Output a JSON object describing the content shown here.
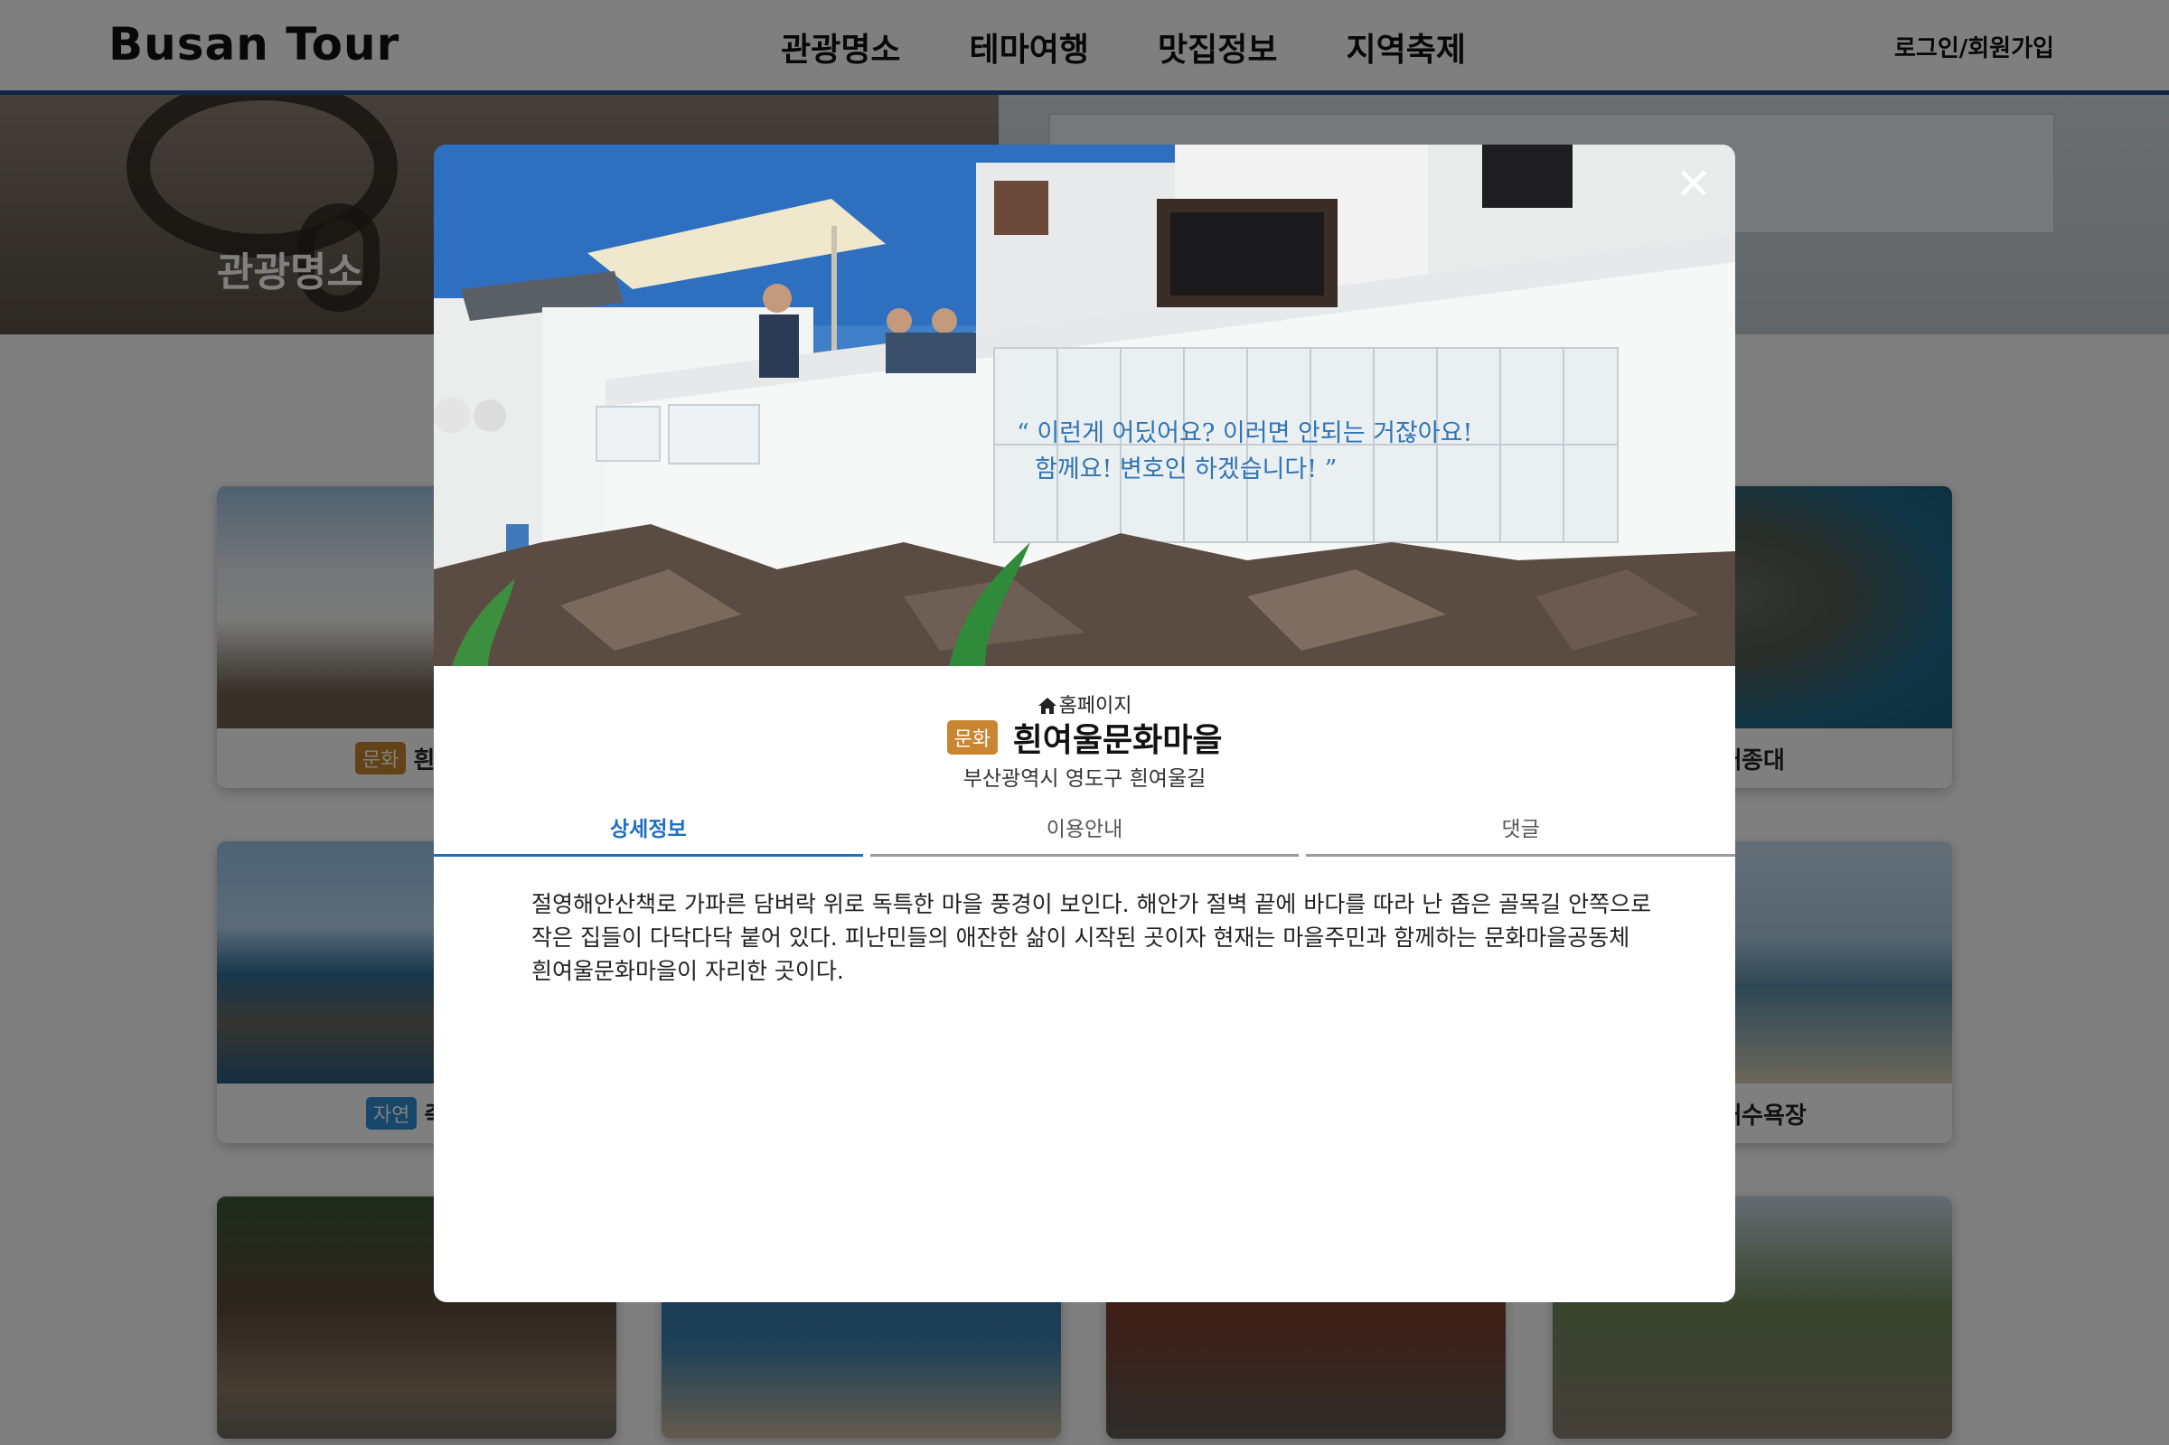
{
  "header": {
    "logo": "Busan Tour",
    "nav": [
      "관광명소",
      "테마여행",
      "맛집정보",
      "지역축제"
    ],
    "login": "로그인/회원가입"
  },
  "hero": {
    "title": "관광명소"
  },
  "cards": [
    {
      "badge": "문화",
      "title": "흰여울"
    },
    {
      "badge": "",
      "title": "태종대"
    },
    {
      "badge": "자연",
      "title": "죽성"
    },
    {
      "badge": "",
      "title": "광해수욕장"
    }
  ],
  "modal": {
    "close_icon": "✕",
    "home_label": "홈페이지",
    "badge": "문화",
    "title": "흰여울문화마을",
    "address": "부산광역시 영도구 흰여울길",
    "tabs": [
      "상세정보",
      "이용안내",
      "댓글"
    ],
    "active_tab": "상세정보",
    "description": "절영해안산책로 가파른 담벼락 위로 독특한 마을 풍경이 보인다. 해안가 절벽 끝에 바다를 따라 난 좁은 골목길 안쪽으로 작은 집들이 다닥다닥 붙어 있다. 피난민들의 애잔한 삶이 시작된 곳이자 현재는 마을주민과 함께하는 문화마을공동체 흰여울문화마을이 자리한 곳이다.",
    "photo_sign_line1": "“ 이런게 어딨어요? 이러면 안되는 거잖아요!",
    "photo_sign_line2": "함께요! 변호인 하겠습니다! ”"
  },
  "colors": {
    "header_border": "#1f4f8f",
    "tab_active": "#1f6fbf",
    "badge_culture": "#c98531",
    "badge_nature": "#2f8fd6"
  }
}
